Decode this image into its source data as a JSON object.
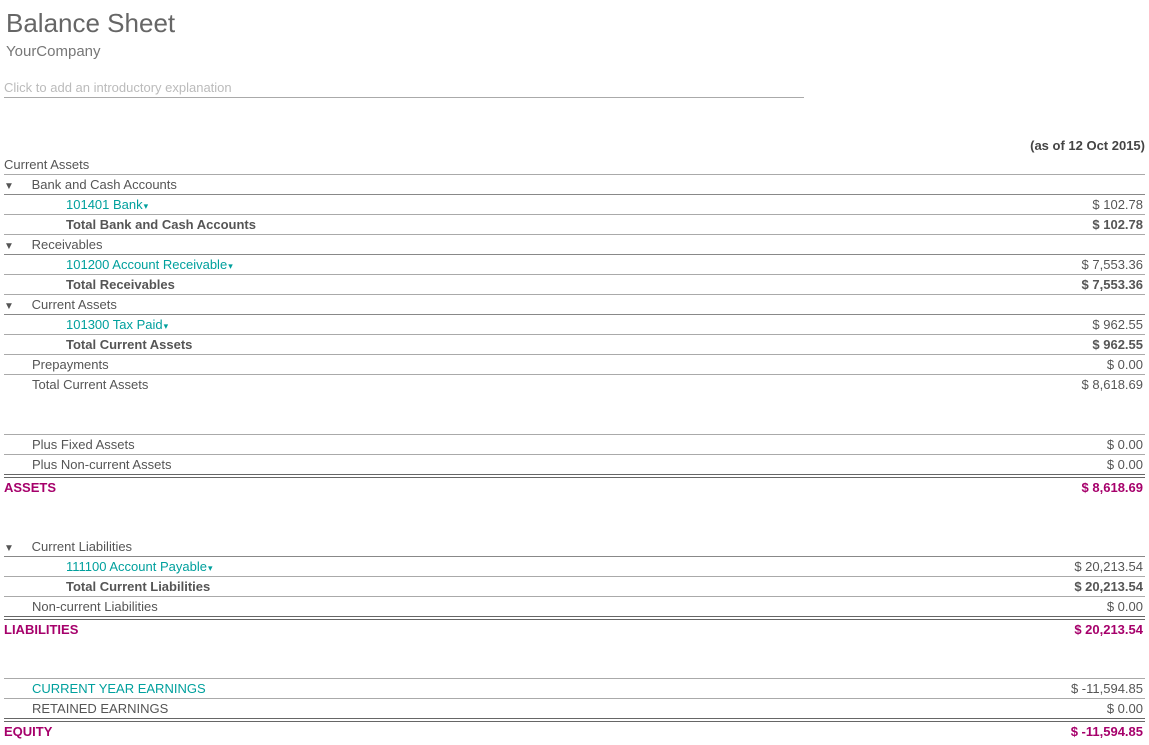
{
  "title": "Balance Sheet",
  "company": "YourCompany",
  "intro_placeholder": "Click to add an introductory explanation",
  "as_of": "(as of 12 Oct 2015)",
  "section_current_assets": "Current Assets",
  "rows": {
    "bank_cash_accounts": "Bank and Cash Accounts",
    "bank_101401": "101401 Bank",
    "bank_101401_val": "$ 102.78",
    "total_bank_cash": "Total Bank and Cash Accounts",
    "total_bank_cash_val": "$ 102.78",
    "receivables": "Receivables",
    "acct_receivable": "101200 Account Receivable",
    "acct_receivable_val": "$ 7,553.36",
    "total_receivables": "Total Receivables",
    "total_receivables_val": "$ 7,553.36",
    "current_assets_inner": "Current Assets",
    "tax_paid": "101300 Tax Paid",
    "tax_paid_val": "$ 962.55",
    "total_current_assets_inner": "Total Current Assets",
    "total_current_assets_inner_val": "$ 962.55",
    "prepayments": "Prepayments",
    "prepayments_val": "$ 0.00",
    "total_current_assets": "Total Current Assets",
    "total_current_assets_val": "$ 8,618.69",
    "plus_fixed": "Plus Fixed Assets",
    "plus_fixed_val": "$ 0.00",
    "plus_noncurrent": "Plus Non-current Assets",
    "plus_noncurrent_val": "$ 0.00",
    "assets": "ASSETS",
    "assets_val": "$ 8,618.69",
    "current_liabilities": "Current Liabilities",
    "acct_payable": "111100 Account Payable",
    "acct_payable_val": "$ 20,213.54",
    "total_current_liab": "Total Current Liabilities",
    "total_current_liab_val": "$ 20,213.54",
    "noncurrent_liab": "Non-current Liabilities",
    "noncurrent_liab_val": "$ 0.00",
    "liabilities": "LIABILITIES",
    "liabilities_val": "$ 20,213.54",
    "current_year_earnings": "CURRENT YEAR EARNINGS",
    "current_year_earnings_val": "$ -11,594.85",
    "retained_earnings": "RETAINED EARNINGS",
    "retained_earnings_val": "$ 0.00",
    "equity": "EQUITY",
    "equity_val": "$ -11,594.85"
  }
}
